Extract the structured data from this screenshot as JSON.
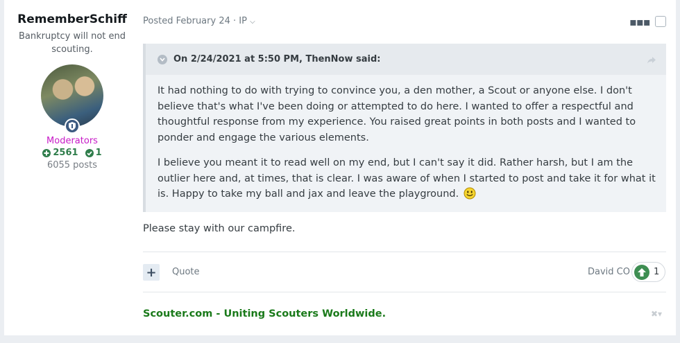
{
  "author": {
    "username": "RememberSchiff",
    "tagline": "Bankruptcy will not end scouting.",
    "group": "Moderators",
    "reputation": "2561",
    "solutions": "1",
    "posts": "6055 posts"
  },
  "post": {
    "meta": "Posted February 24 · IP",
    "quote": {
      "citation": "On 2/24/2021 at 5:50 PM, ThenNow said:",
      "paragraph1": "It had nothing to do with trying to convince you, a den mother, a Scout or anyone else. I don't believe that's what I've been doing or attempted to do here. I wanted to offer a respectful and thoughtful response from my experience. You raised great points in both posts and I wanted to ponder and engage the various elements.",
      "paragraph2": "I believe you meant it to read well on my end, but I can't say it did. Rather harsh, but I am the outlier here and, at times, that is clear. I was aware of when I started to post and take it for what it is. Happy to take my ball and jax and leave the playground."
    },
    "reply": "Please stay with our campfire.",
    "actions": {
      "multiquote": "+",
      "quote_label": "Quote"
    },
    "reaction": {
      "reactor": "David CO",
      "count": "1"
    },
    "signature": "Scouter.com - Uniting Scouters Worldwide."
  },
  "icons": {
    "menu": "ellipsis-icon",
    "quote_toggle": "chevron-down-icon",
    "share": "share-icon",
    "reaction": "upvote-icon",
    "badge": "shield-icon",
    "smiley": "smiley-icon"
  },
  "colors": {
    "group": "#c71ac7",
    "reputation": "#2f7d4b",
    "signature": "#1a7a1a",
    "reaction": "#3e8e52"
  }
}
